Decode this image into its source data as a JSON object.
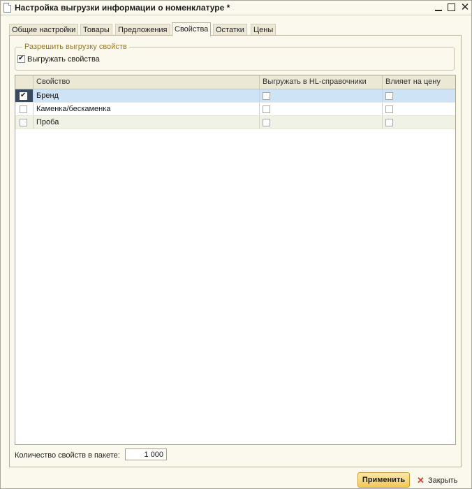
{
  "window": {
    "title": "Настройка выгрузки информации о номенклатуре *"
  },
  "tabs": [
    {
      "label": "Общие настройки"
    },
    {
      "label": "Товары"
    },
    {
      "label": "Предложения"
    },
    {
      "label": "Свойства",
      "active": true
    },
    {
      "label": "Остатки"
    },
    {
      "label": "Цены"
    }
  ],
  "group": {
    "legend": "Разрешить выгрузку свойств",
    "checkbox_label": "Выгружать свойства",
    "checked": true
  },
  "table": {
    "columns": [
      "",
      "Свойство",
      "Выгружать в HL-справочники",
      "Влияет на цену"
    ],
    "rows": [
      {
        "enabled": true,
        "name": "Бренд",
        "hl": false,
        "price": false
      },
      {
        "enabled": false,
        "name": "Каменка/бескаменка",
        "hl": false,
        "price": false
      },
      {
        "enabled": false,
        "name": "Проба",
        "hl": false,
        "price": false
      }
    ]
  },
  "batch": {
    "label": "Количество свойств в пакете:",
    "value": "1 000"
  },
  "footer": {
    "apply_label": "Применить",
    "close_label": "Закрыть"
  },
  "colors": {
    "accent": "#f2c95a",
    "selected_row": "#cfe3f7",
    "legend_text": "#9a7a2a",
    "close_icon": "#d9412b"
  }
}
